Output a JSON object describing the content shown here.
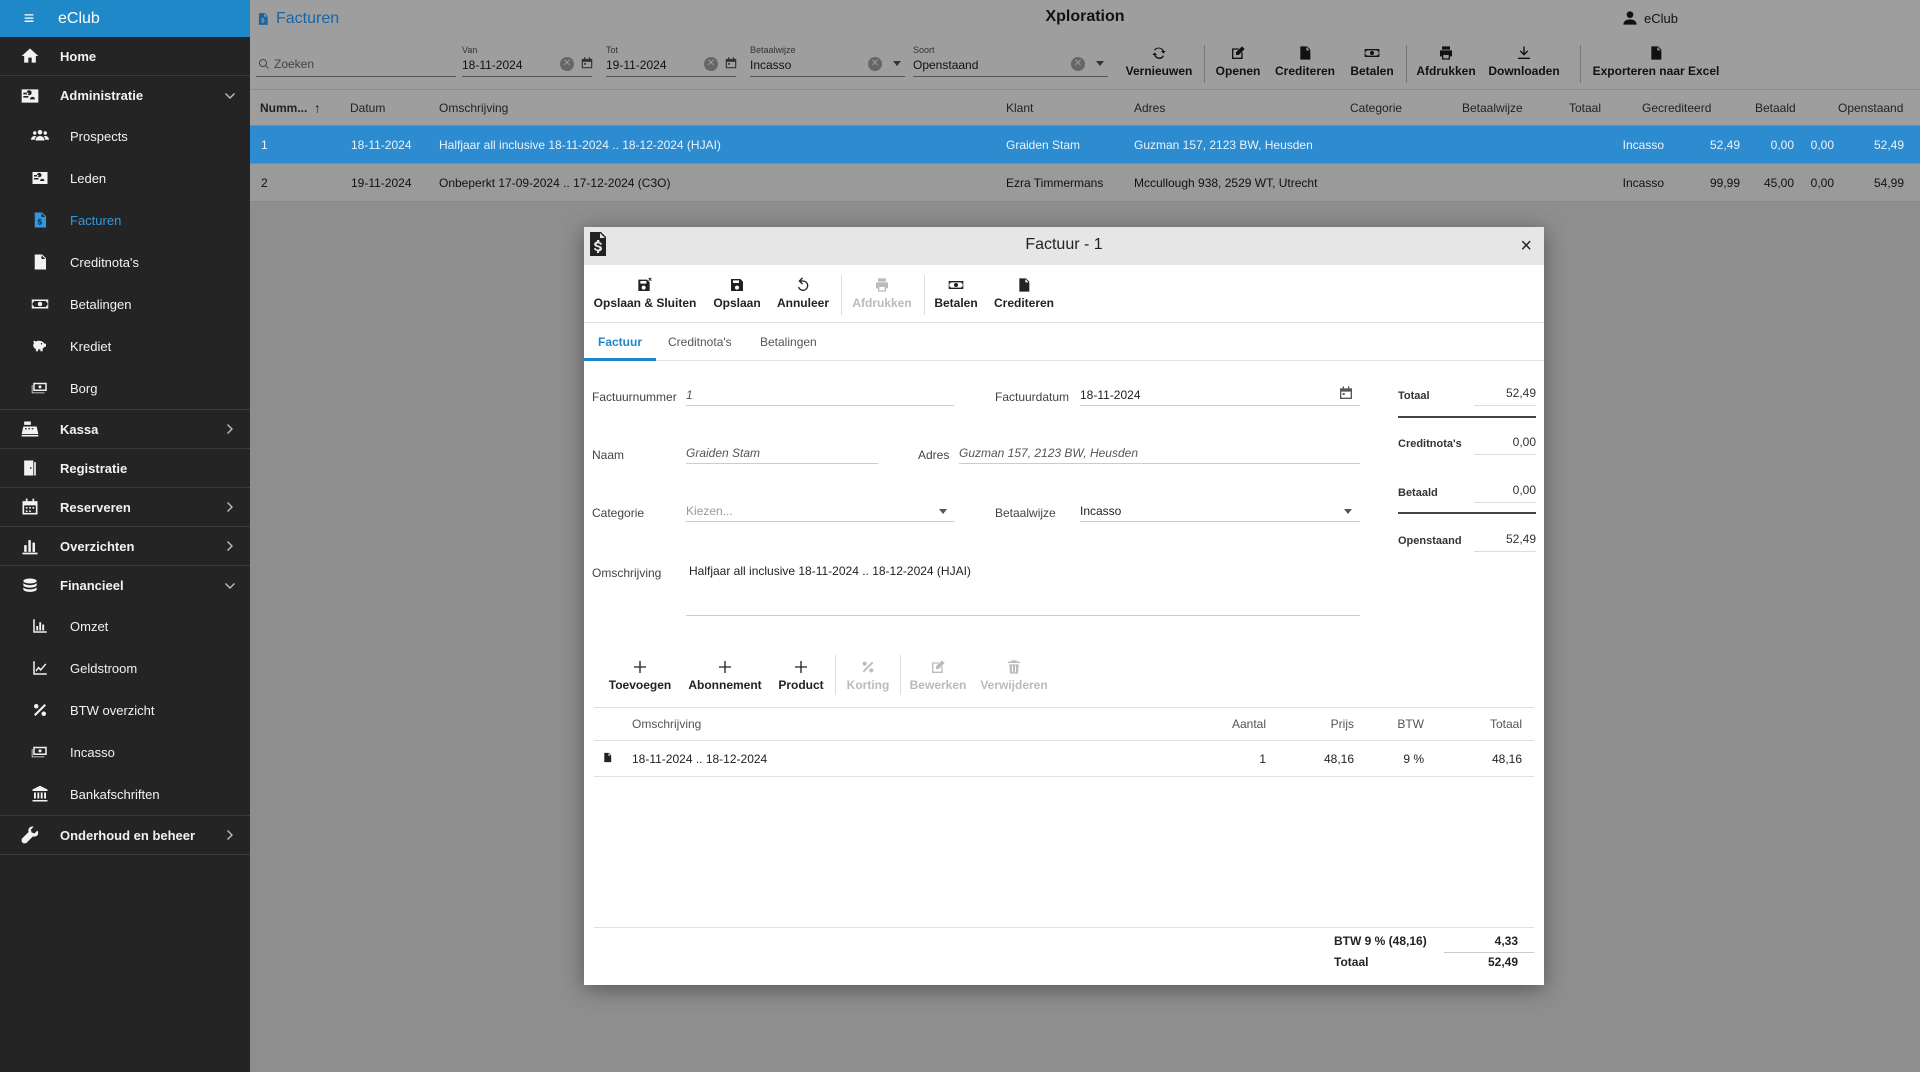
{
  "sidebar": {
    "brand": "eClub",
    "items": [
      {
        "label": "Home",
        "icon": "home-icon",
        "type": "top"
      },
      {
        "label": "Administratie",
        "icon": "id-card-icon",
        "type": "top",
        "expanded": true
      },
      {
        "label": "Prospects",
        "icon": "users-icon",
        "type": "sub"
      },
      {
        "label": "Leden",
        "icon": "id-card-icon",
        "type": "sub"
      },
      {
        "label": "Facturen",
        "icon": "invoice-icon",
        "type": "sub",
        "active": true
      },
      {
        "label": "Creditnota's",
        "icon": "document-icon",
        "type": "sub"
      },
      {
        "label": "Betalingen",
        "icon": "money-icon",
        "type": "sub"
      },
      {
        "label": "Krediet",
        "icon": "piggy-bank-icon",
        "type": "sub"
      },
      {
        "label": "Borg",
        "icon": "cash-icon",
        "type": "sub"
      },
      {
        "label": "Kassa",
        "icon": "cash-register-icon",
        "type": "top"
      },
      {
        "label": "Registratie",
        "icon": "door-icon",
        "type": "top"
      },
      {
        "label": "Reserveren",
        "icon": "calendar-icon",
        "type": "top"
      },
      {
        "label": "Overzichten",
        "icon": "bar-chart-icon",
        "type": "top"
      },
      {
        "label": "Financieel",
        "icon": "coins-icon",
        "type": "top",
        "expanded": true
      },
      {
        "label": "Omzet",
        "icon": "bar-chart-icon",
        "type": "sub"
      },
      {
        "label": "Geldstroom",
        "icon": "line-chart-icon",
        "type": "sub"
      },
      {
        "label": "BTW overzicht",
        "icon": "percent-icon",
        "type": "sub"
      },
      {
        "label": "Incasso",
        "icon": "cash-icon",
        "type": "sub"
      },
      {
        "label": "Bankafschriften",
        "icon": "bank-icon",
        "type": "sub"
      },
      {
        "label": "Onderhoud en beheer",
        "icon": "wrench-icon",
        "type": "top"
      }
    ]
  },
  "header": {
    "title": "Facturen",
    "app_name": "Xploration",
    "user": "eClub"
  },
  "filters": {
    "search_placeholder": "Zoeken",
    "van_label": "Van",
    "van_value": "18-11-2024",
    "tot_label": "Tot",
    "tot_value": "19-11-2024",
    "betaalwijze_label": "Betaalwijze",
    "betaalwijze_value": "Incasso",
    "soort_label": "Soort",
    "soort_value": "Openstaand"
  },
  "toolbar": {
    "vernieuwen": "Vernieuwen",
    "openen": "Openen",
    "crediteren": "Crediteren",
    "betalen": "Betalen",
    "afdrukken": "Afdrukken",
    "downloaden": "Downloaden",
    "exporteren": "Exporteren naar Excel"
  },
  "grid": {
    "columns": [
      "Numm...",
      "Datum",
      "Omschrijving",
      "Klant",
      "Adres",
      "Categorie",
      "Betaalwijze",
      "Totaal",
      "Gecrediteerd",
      "Betaald",
      "Openstaand"
    ],
    "rows": [
      [
        "1",
        "18-11-2024",
        "Halfjaar all inclusive  18-11-2024 .. 18-12-2024  (HJAI)",
        "Graiden Stam",
        "Guzman 157, 2123 BW, Heusden",
        "",
        "Incasso",
        "52,49",
        "0,00",
        "0,00",
        "52,49"
      ],
      [
        "2",
        "19-11-2024",
        "Onbeperkt  17-09-2024 .. 17-12-2024  (C3O)",
        "Ezra Timmermans",
        "Mccullough 938, 2529 WT, Utrecht",
        "",
        "Incasso",
        "99,99",
        "0,00",
        "45,00",
        "54,99"
      ]
    ]
  },
  "modal": {
    "title": "Factuur - 1",
    "close": "×",
    "tools": {
      "save_close": "Opslaan & Sluiten",
      "save": "Opslaan",
      "cancel": "Annuleer",
      "print": "Afdrukken",
      "pay": "Betalen",
      "credit": "Crediteren"
    },
    "tabs": [
      "Factuur",
      "Creditnota's",
      "Betalingen"
    ],
    "form": {
      "factuurnummer_label": "Factuurnummer",
      "factuurnummer_value": "1",
      "factuurdatum_label": "Factuurdatum",
      "factuurdatum_value": "18-11-2024",
      "naam_label": "Naam",
      "naam_value": "Graiden Stam",
      "adres_label": "Adres",
      "adres_value": "Guzman 157, 2123 BW, Heusden",
      "categorie_label": "Categorie",
      "categorie_placeholder": "Kiezen...",
      "betaalwijze_label": "Betaalwijze",
      "betaalwijze_value": "Incasso",
      "omschrijving_label": "Omschrijving",
      "omschrijving_value": "Halfjaar all inclusive  18-11-2024 .. 18-12-2024  (HJAI)"
    },
    "summary": {
      "totaal_label": "Totaal",
      "totaal_value": "52,49",
      "creditnotas_label": "Creditnota's",
      "creditnotas_value": "0,00",
      "betaald_label": "Betaald",
      "betaald_value": "0,00",
      "openstaand_label": "Openstaand",
      "openstaand_value": "52,49"
    },
    "line_tools": {
      "toevoegen": "Toevoegen",
      "abonnement": "Abonnement",
      "product": "Product",
      "korting": "Korting",
      "bewerken": "Bewerken",
      "verwijderen": "Verwijderen"
    },
    "lines": {
      "columns": [
        "Omschrijving",
        "Aantal",
        "Prijs",
        "BTW",
        "Totaal"
      ],
      "rows": [
        [
          "18-11-2024 .. 18-12-2024",
          "1",
          "48,16",
          "9 %",
          "48,16"
        ]
      ]
    },
    "footer": {
      "btw_label": "BTW 9 % (48,16)",
      "btw_value": "4,33",
      "totaal_label": "Totaal",
      "totaal_value": "52,49"
    }
  }
}
